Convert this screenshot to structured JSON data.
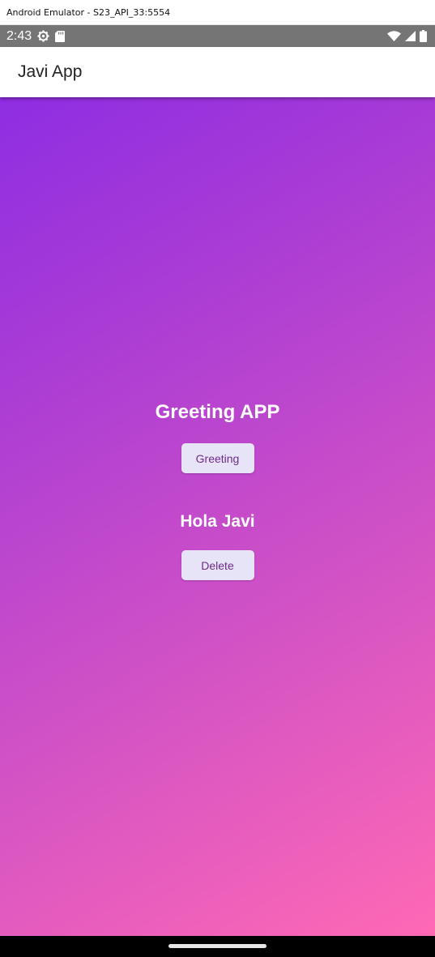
{
  "window": {
    "title": "Android Emulator - S23_API_33:5554"
  },
  "status_bar": {
    "time": "2:43",
    "left_icons": [
      "settings-icon",
      "sd-card-icon"
    ],
    "right_icons": [
      "wifi-icon",
      "signal-icon",
      "battery-icon"
    ]
  },
  "app_bar": {
    "title": "Javi App"
  },
  "main": {
    "heading": "Greeting APP",
    "greeting_button": "Greeting",
    "message": "Hola Javi",
    "delete_button": "Delete"
  },
  "colors": {
    "gradient_start": "#8e2de2",
    "gradient_end": "#ff69b4",
    "button_bg": "#e8e4f8",
    "button_text": "#6b2a86",
    "status_bar": "#757575"
  }
}
